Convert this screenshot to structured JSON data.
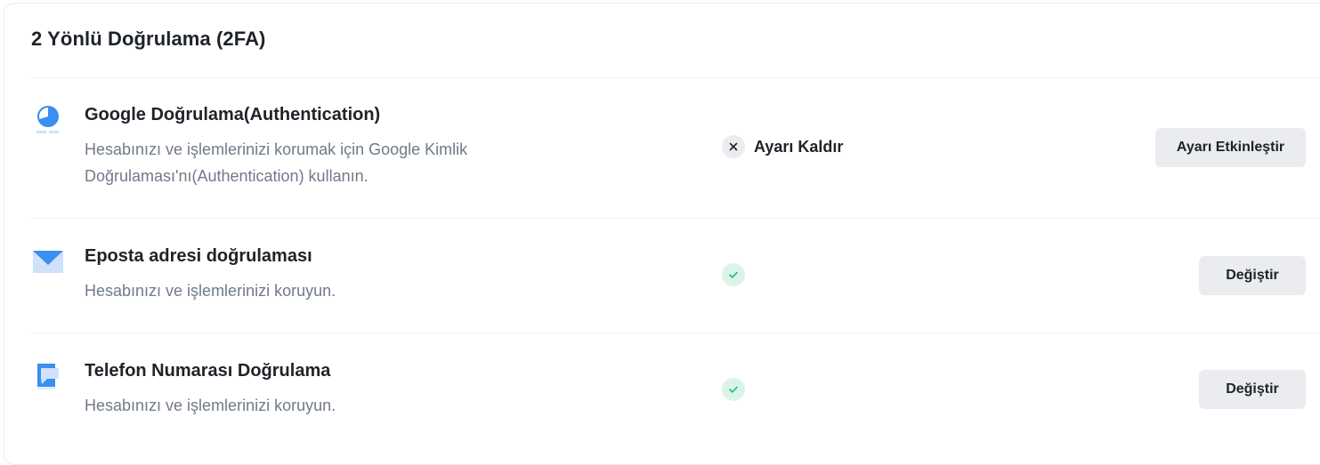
{
  "section": {
    "title": "2 Yönlü Doğrulama (2FA)"
  },
  "colors": {
    "accent_blue": "#3a8ff0",
    "success_green": "#02c076",
    "button_bg": "#eaecef",
    "text_primary": "#1e2329",
    "text_secondary": "#707a8a"
  },
  "rows": [
    {
      "icon": "google-authenticator-icon",
      "title": "Google Doğrulama(Authentication)",
      "desc_line1": "Hesabınızı ve işlemlerinizi korumak için Google Kimlik",
      "desc_line2": "Doğrulaması'nı(Authentication) kullanın.",
      "status_icon": "close-icon",
      "status_text": "Ayarı Kaldır",
      "button_label": "Ayarı Etkinleştir"
    },
    {
      "icon": "envelope-icon",
      "title": "Eposta adresi doğrulaması",
      "desc_line1": "Hesabınızı ve işlemlerinizi koruyun.",
      "status_icon": "check-icon",
      "button_label": "Değiştir"
    },
    {
      "icon": "phone-message-icon",
      "title": "Telefon Numarası Doğrulama",
      "desc_line1": "Hesabınızı ve işlemlerinizi koruyun.",
      "status_icon": "check-icon",
      "button_label": "Değiştir"
    }
  ]
}
